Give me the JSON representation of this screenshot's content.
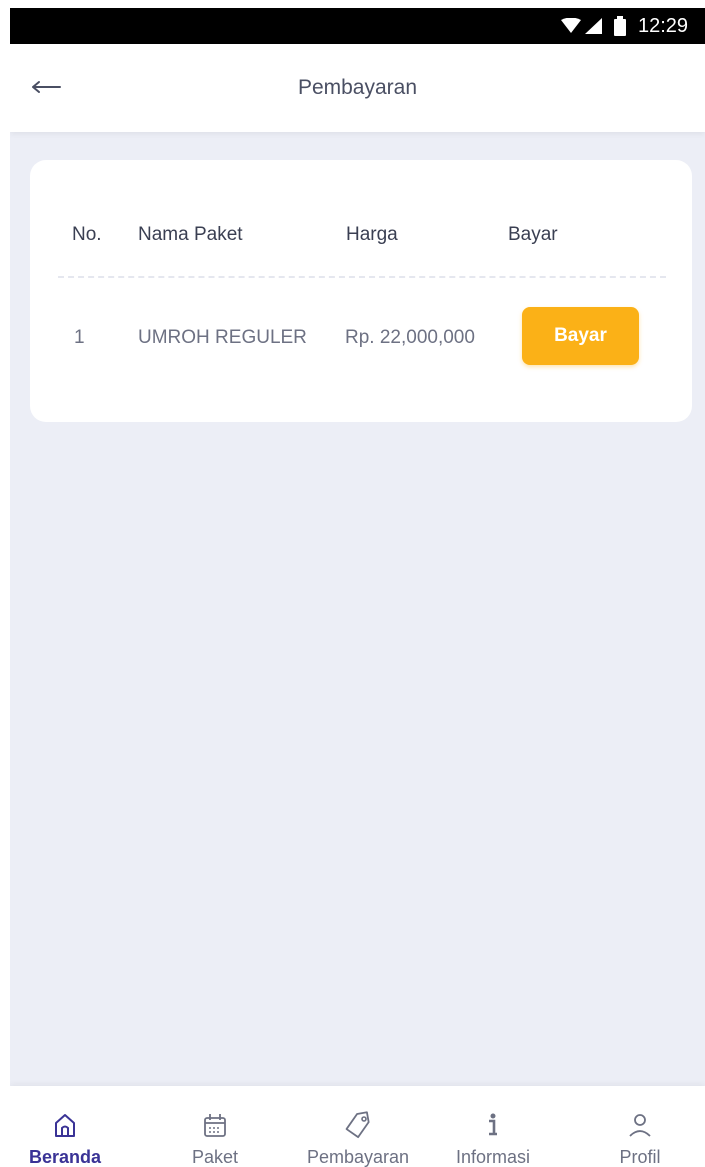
{
  "status_bar": {
    "time": "12:29"
  },
  "app_bar": {
    "title": "Pembayaran"
  },
  "table": {
    "headers": {
      "no": "No.",
      "name": "Nama Paket",
      "price": "Harga",
      "pay": "Bayar"
    },
    "rows": [
      {
        "no": "1",
        "name": "UMROH REGULER",
        "price": "Rp. 22,000,000",
        "action": "Bayar"
      }
    ]
  },
  "bottom_nav": {
    "items": [
      {
        "label": "Beranda",
        "icon": "home-icon",
        "active": true
      },
      {
        "label": "Paket",
        "icon": "calendar-icon"
      },
      {
        "label": "Pembayaran",
        "icon": "tag-icon"
      },
      {
        "label": "Informasi",
        "icon": "info-icon"
      },
      {
        "label": "Profil",
        "icon": "user-icon"
      }
    ]
  },
  "colors": {
    "accent": "#fbb117",
    "active_nav": "#3a3396",
    "background": "#eceef6",
    "text_primary": "#3a3f52",
    "text_secondary": "#6d7183"
  }
}
